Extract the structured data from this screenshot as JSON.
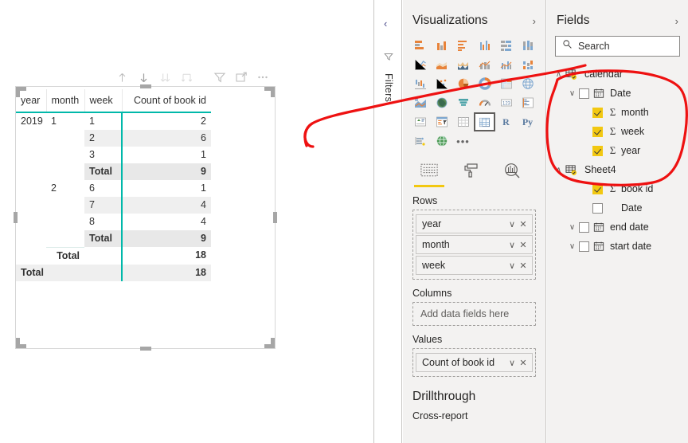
{
  "canvas": {
    "visual_header": {
      "buttons": [
        {
          "name": "drill-up-icon",
          "label": "Drill up",
          "state": "enabled"
        },
        {
          "name": "drill-down-icon",
          "label": "Drill down",
          "state": "active"
        },
        {
          "name": "expand-all-icon",
          "label": "Expand all down one level",
          "state": "disabled"
        },
        {
          "name": "drill-hierarchy-icon",
          "label": "Go to next level",
          "state": "disabled"
        },
        {
          "name": "filter-icon",
          "label": "Filters",
          "state": "enabled"
        },
        {
          "name": "focus-mode-icon",
          "label": "Focus mode",
          "state": "enabled"
        },
        {
          "name": "more-options-icon",
          "label": "More options",
          "state": "enabled"
        }
      ]
    }
  },
  "matrix": {
    "type": "table",
    "accent_color": "#01b8aa",
    "columns": [
      "year",
      "month",
      "week",
      "Count of book id"
    ],
    "rows": [
      {
        "year": "2019",
        "month": "1",
        "week": "1",
        "value": "2",
        "kind": "data",
        "band": false
      },
      {
        "year": "",
        "month": "",
        "week": "2",
        "value": "6",
        "kind": "data",
        "band": true
      },
      {
        "year": "",
        "month": "",
        "week": "3",
        "value": "1",
        "kind": "data",
        "band": false
      },
      {
        "year": "",
        "month": "",
        "week": "Total",
        "value": "9",
        "kind": "subtotal-week",
        "band": true
      },
      {
        "year": "",
        "month": "2",
        "week": "6",
        "value": "1",
        "kind": "data",
        "band": false
      },
      {
        "year": "",
        "month": "",
        "week": "7",
        "value": "4",
        "kind": "data",
        "band": true
      },
      {
        "year": "",
        "month": "",
        "week": "8",
        "value": "4",
        "kind": "data",
        "band": false
      },
      {
        "year": "",
        "month": "",
        "week": "Total",
        "value": "9",
        "kind": "subtotal-week",
        "band": true
      },
      {
        "year": "",
        "month": "Total",
        "week": "",
        "value": "18",
        "kind": "subtotal-month",
        "band": false
      },
      {
        "year": "Total",
        "month": "",
        "week": "",
        "value": "18",
        "kind": "grand-total",
        "band": true
      }
    ]
  },
  "filters_rail": {
    "collapse_label": "‹",
    "title": "Filters",
    "funnel_icon": "filter-funnel-icon"
  },
  "visualizations": {
    "title": "Visualizations",
    "expand_chevron": "›",
    "gallery": [
      {
        "name": "stacked-bar-chart-icon"
      },
      {
        "name": "stacked-column-chart-icon"
      },
      {
        "name": "clustered-bar-chart-icon"
      },
      {
        "name": "clustered-column-chart-icon"
      },
      {
        "name": "100-stacked-bar-chart-icon"
      },
      {
        "name": "100-stacked-column-chart-icon"
      },
      {
        "name": "line-chart-icon"
      },
      {
        "name": "area-chart-icon"
      },
      {
        "name": "stacked-area-chart-icon"
      },
      {
        "name": "line-and-stacked-column-chart-icon"
      },
      {
        "name": "line-and-clustered-column-chart-icon"
      },
      {
        "name": "ribbon-chart-icon"
      },
      {
        "name": "waterfall-chart-icon"
      },
      {
        "name": "scatter-chart-icon"
      },
      {
        "name": "pie-chart-icon"
      },
      {
        "name": "donut-chart-icon"
      },
      {
        "name": "treemap-icon"
      },
      {
        "name": "map-icon"
      },
      {
        "name": "filled-map-icon"
      },
      {
        "name": "shape-map-icon"
      },
      {
        "name": "funnel-chart-icon"
      },
      {
        "name": "gauge-icon"
      },
      {
        "name": "card-icon"
      },
      {
        "name": "multi-row-card-icon"
      },
      {
        "name": "kpi-icon"
      },
      {
        "name": "slicer-icon"
      },
      {
        "name": "table-icon"
      },
      {
        "name": "matrix-icon",
        "selected": true
      },
      {
        "name": "r-script-visual-icon",
        "glyph": "R"
      },
      {
        "name": "python-visual-icon",
        "glyph": "Py"
      },
      {
        "name": "key-influencers-icon"
      },
      {
        "name": "get-more-visuals-icon"
      },
      {
        "name": "more-visuals-ellipsis-icon",
        "glyph": "•••"
      }
    ],
    "well_tabs": [
      {
        "name": "fields-tab",
        "icon": "fields-well-icon",
        "selected": true
      },
      {
        "name": "format-tab",
        "icon": "paint-roller-icon",
        "selected": false
      },
      {
        "name": "analytics-tab",
        "icon": "magnifier-chart-icon",
        "selected": false
      }
    ],
    "wells": [
      {
        "label": "Rows",
        "chips": [
          {
            "name": "year",
            "chevron": "∨",
            "remove": "✕"
          },
          {
            "name": "month",
            "chevron": "∨",
            "remove": "✕"
          },
          {
            "name": "week",
            "chevron": "∨",
            "remove": "✕"
          }
        ]
      },
      {
        "label": "Columns",
        "placeholder": "Add data fields here",
        "chips": []
      },
      {
        "label": "Values",
        "chips": [
          {
            "name": "Count of book id",
            "chevron": "∨",
            "remove": "✕"
          }
        ]
      }
    ],
    "drillthrough": {
      "title": "Drillthrough",
      "cross_report_label": "Cross-report"
    }
  },
  "fields": {
    "title": "Fields",
    "expand_chevron": "›",
    "search": {
      "placeholder": "Search",
      "icon": "search-icon",
      "value": ""
    },
    "tree": [
      {
        "level": 1,
        "label": "calendar",
        "kind": "table",
        "icon": "table-linked-icon",
        "expander": "∧",
        "checked": null
      },
      {
        "level": 2,
        "label": "Date",
        "kind": "date-hierarchy",
        "icon": "calendar-icon",
        "expander": "∨",
        "checked": false
      },
      {
        "level": 3,
        "label": "month",
        "kind": "measure",
        "icon": "sigma-icon",
        "expander": "",
        "checked": true
      },
      {
        "level": 3,
        "label": "week",
        "kind": "measure",
        "icon": "sigma-icon",
        "expander": "",
        "checked": true
      },
      {
        "level": 3,
        "label": "year",
        "kind": "measure",
        "icon": "sigma-icon",
        "expander": "",
        "checked": true
      },
      {
        "level": 1,
        "label": "Sheet4",
        "kind": "table",
        "icon": "table-linked-icon",
        "expander": "∧",
        "checked": null
      },
      {
        "level": 3,
        "label": "book id",
        "kind": "measure",
        "icon": "sigma-icon",
        "expander": "",
        "checked": true
      },
      {
        "level": 3,
        "label": "Date",
        "kind": "field",
        "icon": "",
        "expander": "",
        "checked": false
      },
      {
        "level": 2,
        "label": "end date",
        "kind": "date-hierarchy",
        "icon": "calendar-icon",
        "expander": "∨",
        "checked": false
      },
      {
        "level": 2,
        "label": "start date",
        "kind": "date-hierarchy",
        "icon": "calendar-icon",
        "expander": "∨",
        "checked": false
      }
    ]
  },
  "annotation": {
    "color": "#ee1111",
    "shapes": [
      "arrow-to-fields-pane",
      "ellipse-around-calendar-fields"
    ]
  }
}
